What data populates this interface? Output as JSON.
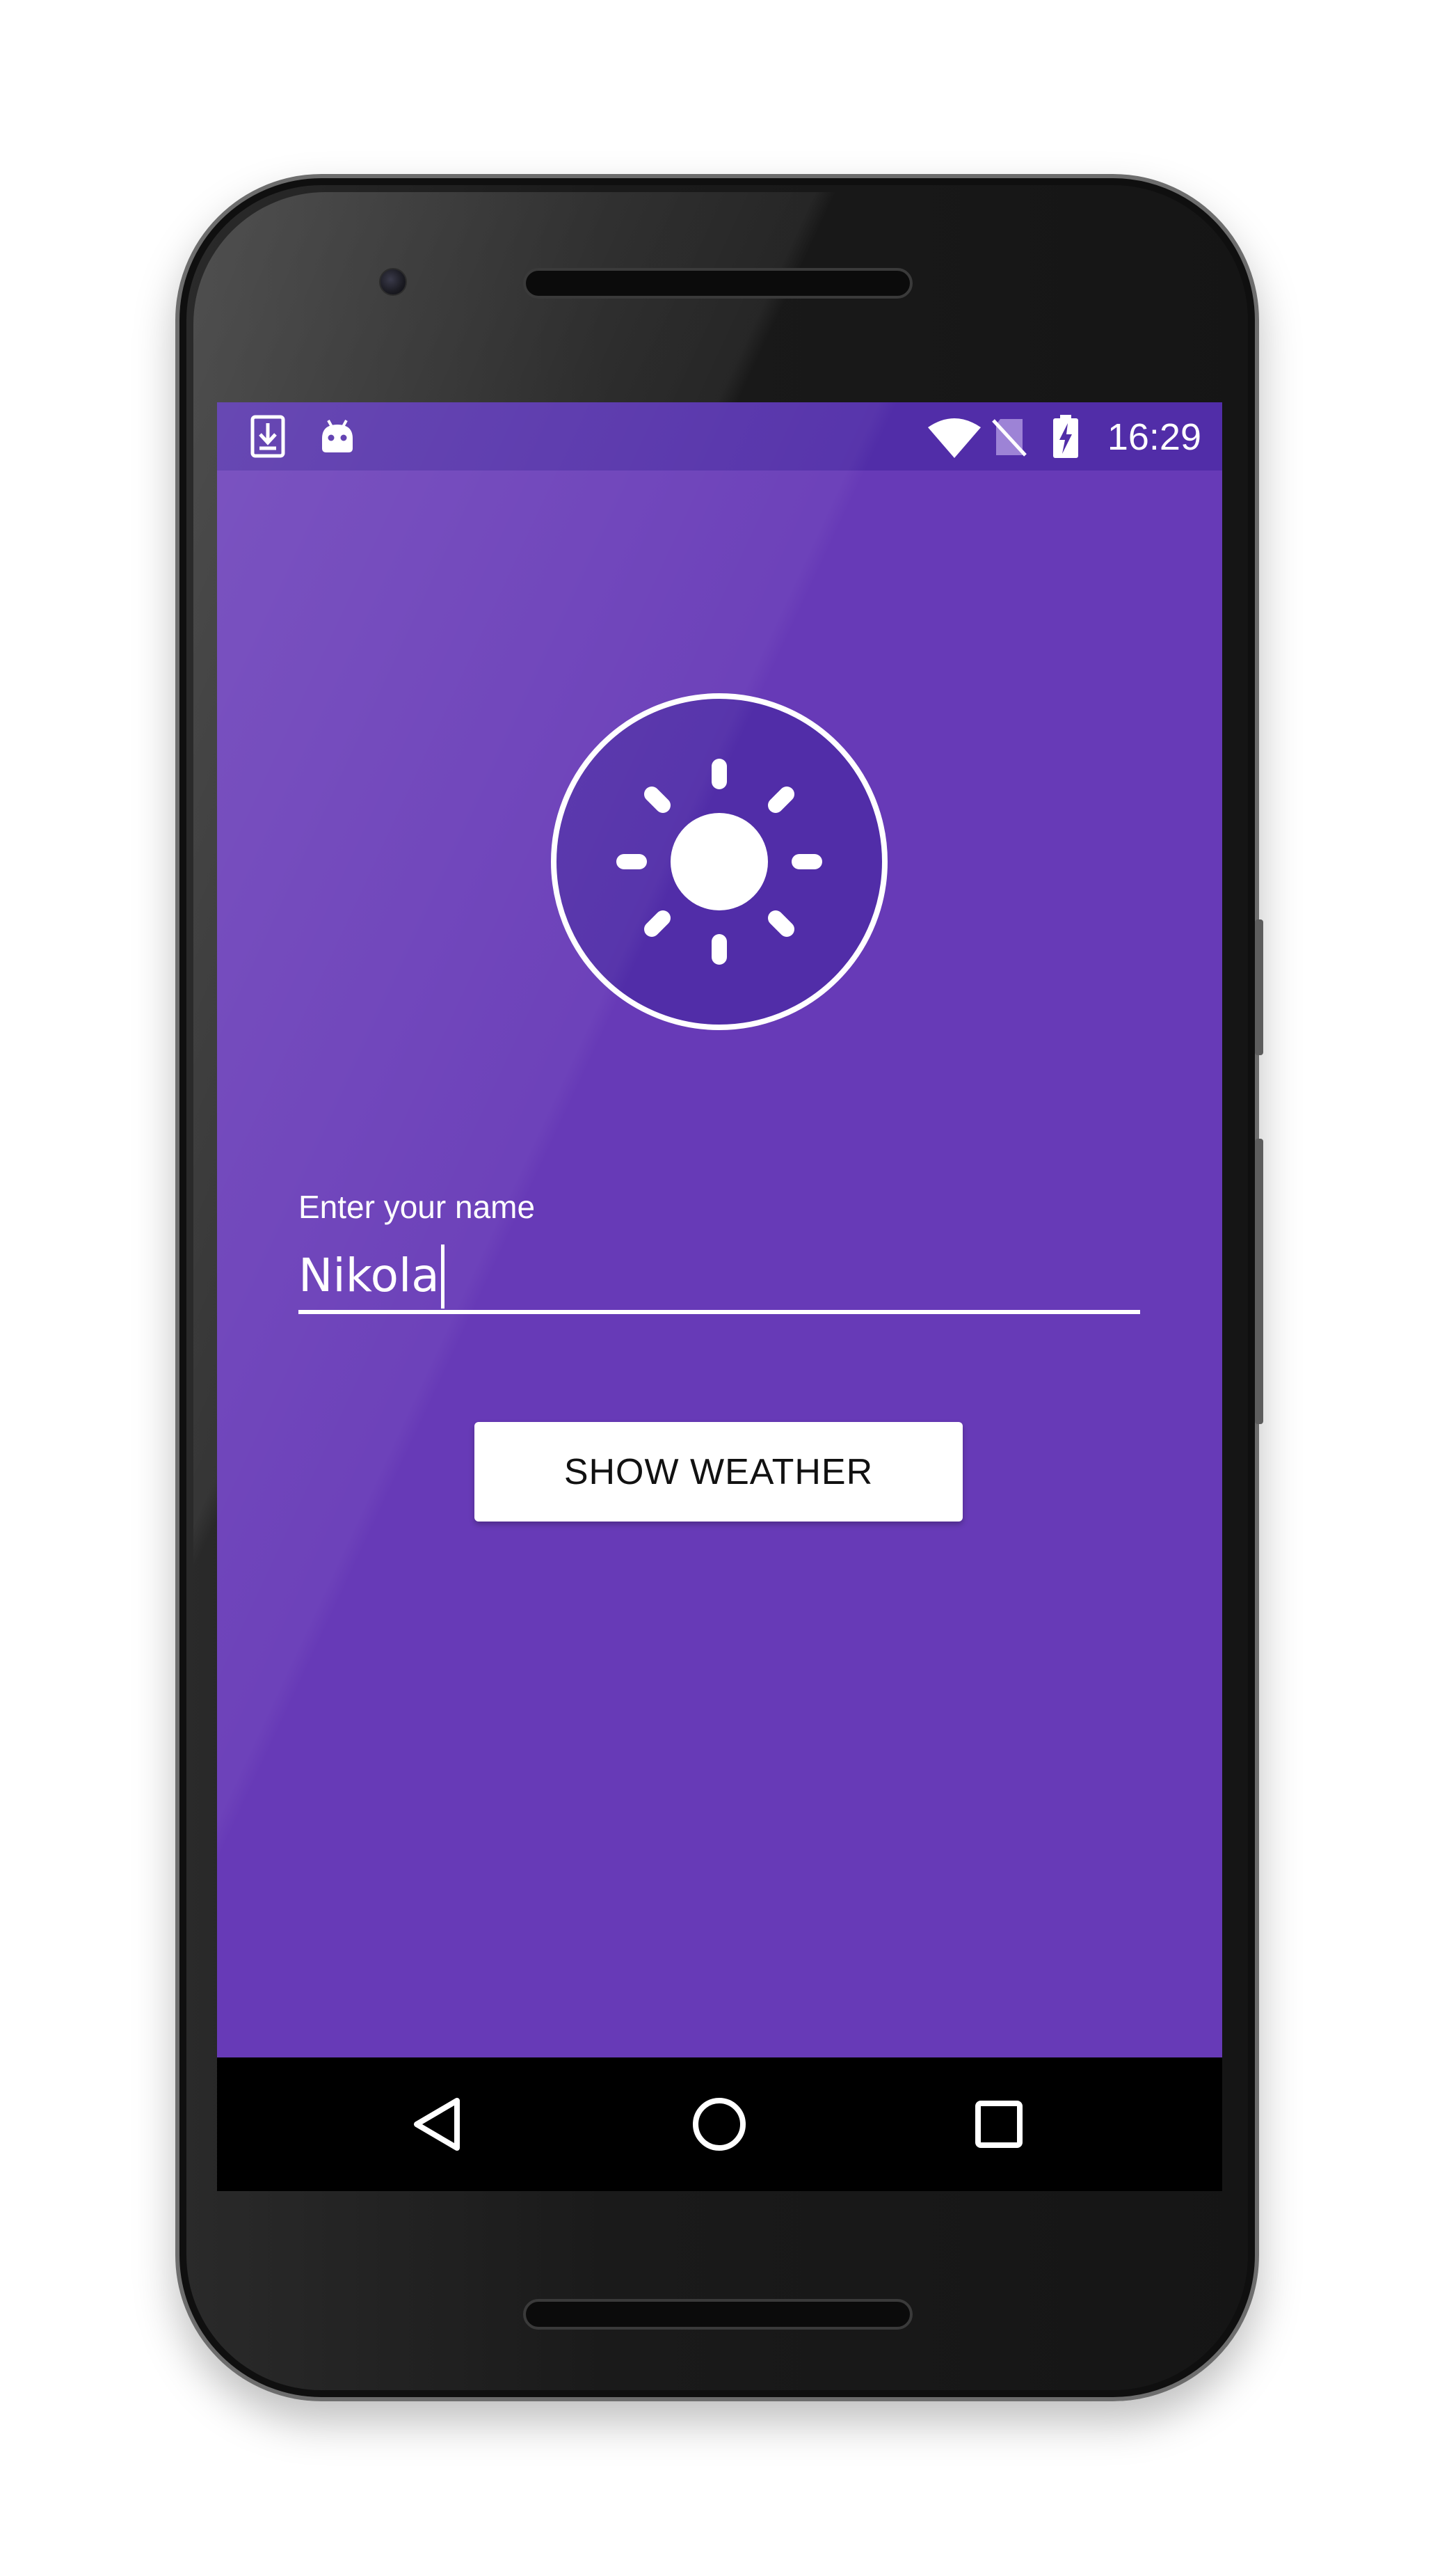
{
  "status_bar": {
    "time": "16:29",
    "left_icons": [
      "download-icon",
      "android-icon"
    ],
    "right_icons": [
      "wifi-icon",
      "no-sim-icon",
      "battery-charging-icon"
    ]
  },
  "app": {
    "logo_icon": "sun-icon",
    "name_label": "Enter your name",
    "name_value": "Nikola",
    "show_weather_button": "SHOW WEATHER"
  },
  "nav_bar": {
    "buttons": [
      "back-icon",
      "home-icon",
      "recents-icon"
    ]
  },
  "colors": {
    "primary": "#673ab7",
    "primary_dark": "#512da8",
    "accent": "#ffffff"
  }
}
